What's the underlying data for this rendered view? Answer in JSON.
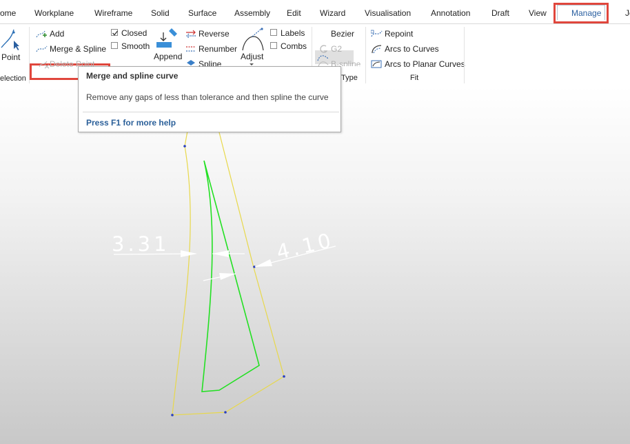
{
  "tabs": [
    "ome",
    "Workplane",
    "Wireframe",
    "Solid",
    "Surface",
    "Assembly",
    "Edit",
    "Wizard",
    "Visualisation",
    "Annotation",
    "Draft",
    "View",
    "Manage",
    "Je"
  ],
  "ribbon": {
    "point_label": "Point",
    "selection_group": "election",
    "add_label": "Add",
    "merge_spline_label": "Merge & Spline",
    "delete_point_label": "Delete Point",
    "closed_label": "Closed",
    "smooth_label": "Smooth",
    "append_label": "Append",
    "reverse_label": "Reverse",
    "renumber_label": "Renumber",
    "spline_label": "Spline",
    "adjust_label": "Adjust",
    "labels_label": "Labels",
    "combs_label": "Combs",
    "bezier_label": "Bezier",
    "g2_label": "G2",
    "bspline_label": "B-spline",
    "type_group": "Type",
    "repoint_label": "Repoint",
    "arcs_to_curves_label": "Arcs to Curves",
    "arcs_to_planar_label": "Arcs to Planar Curves",
    "fit_group": "Fit",
    "closed_checked": true,
    "smooth_checked": false,
    "labels_checked": false,
    "combs_checked": false
  },
  "tooltip": {
    "title": "Merge and spline curve",
    "body": "Remove any gaps of less than tolerance and then spline the curve",
    "help": "Press F1 for more help"
  },
  "canvas": {
    "dim_left": "3.31",
    "dim_right": "4.10",
    "colors": {
      "outer_curve": "#e8d84a",
      "inner_curve": "#22e022",
      "highlight": "#e0463c",
      "accent": "#2a5fa0"
    }
  }
}
